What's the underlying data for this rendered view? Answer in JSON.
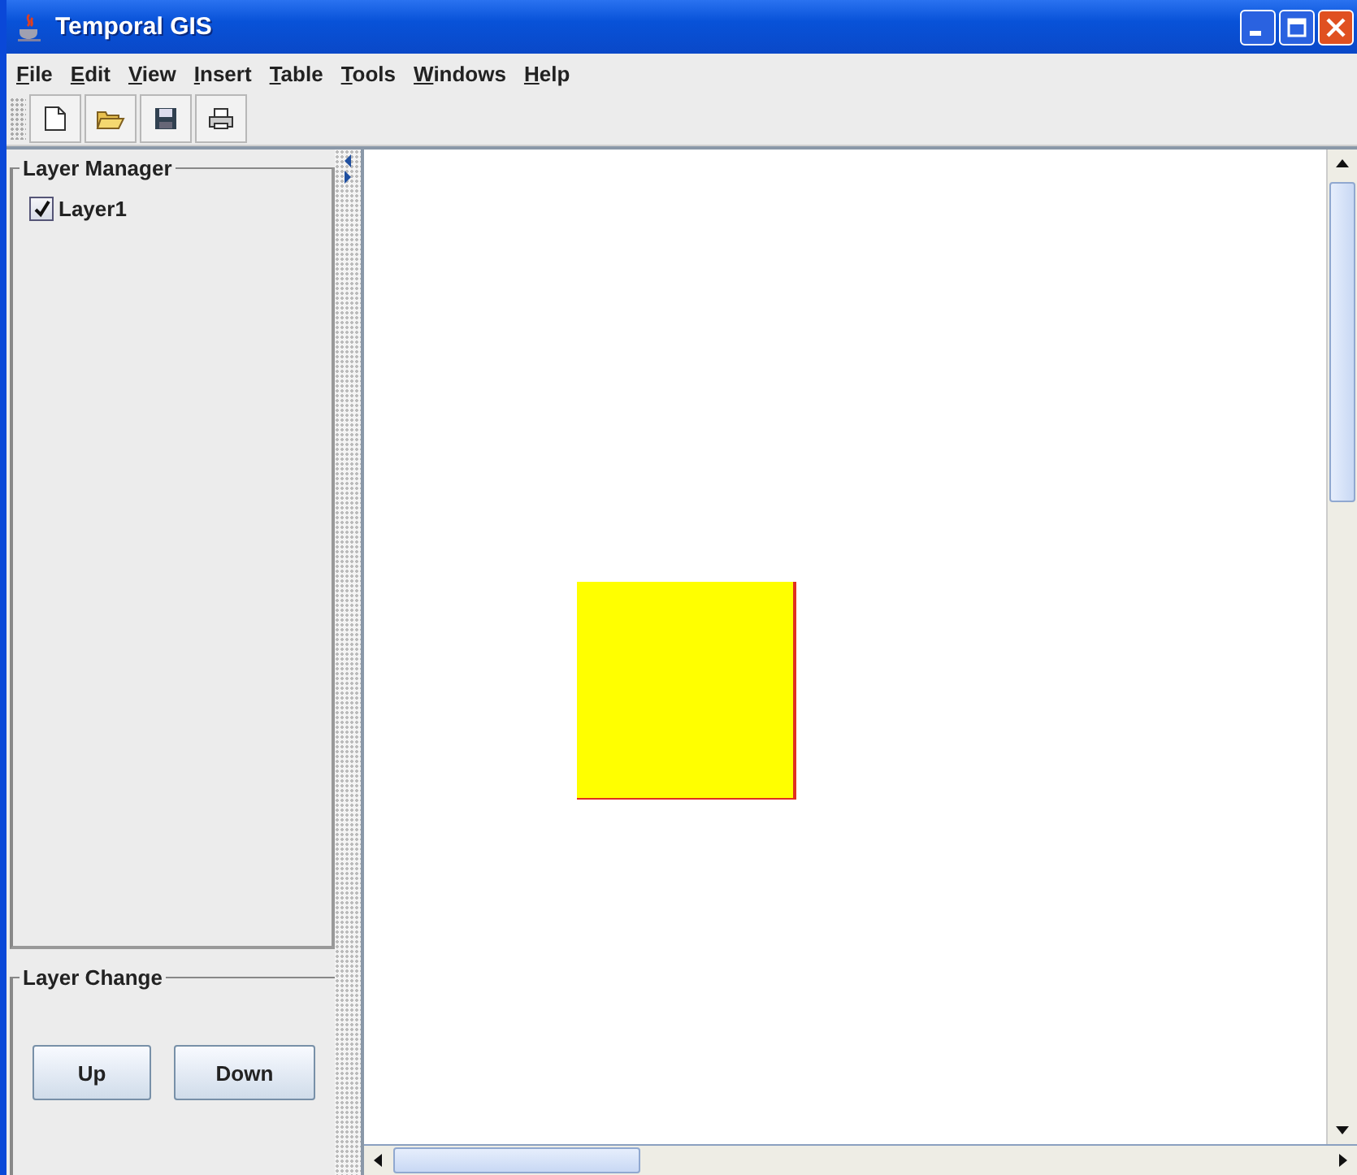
{
  "window": {
    "title": "Temporal GIS"
  },
  "menu": [
    "File",
    "Edit",
    "View",
    "Insert",
    "Table",
    "Tools",
    "Windows",
    "Help"
  ],
  "layer_manager": {
    "title": "Layer Manager",
    "layers": [
      {
        "name": "Layer1",
        "checked": true
      }
    ]
  },
  "layer_change": {
    "title": "Layer Change",
    "buttons": [
      "Up",
      "Down"
    ]
  }
}
